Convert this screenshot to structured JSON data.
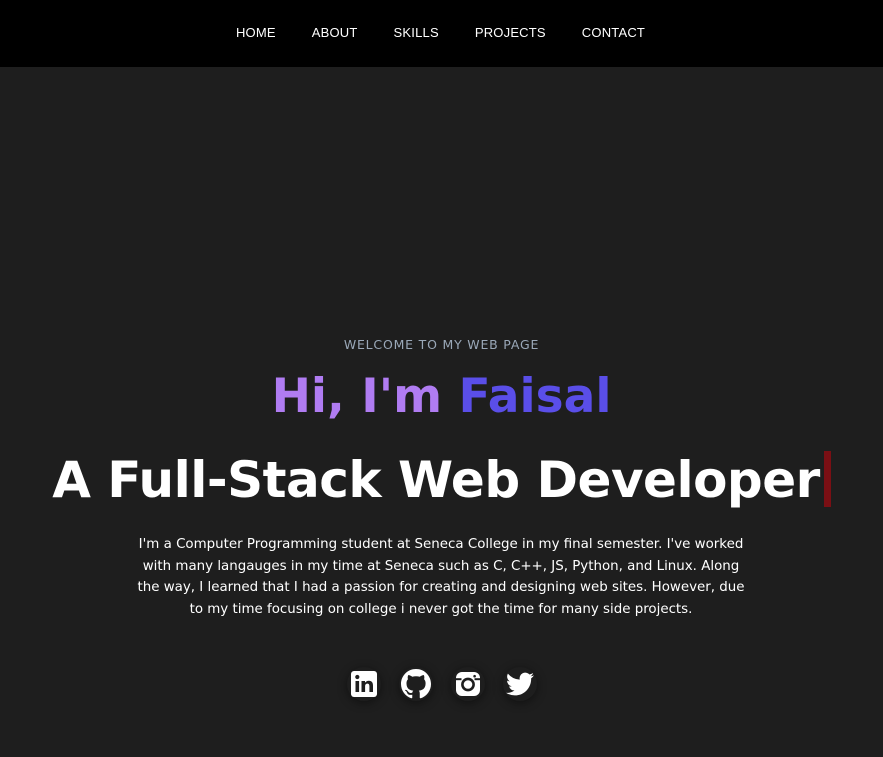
{
  "nav": {
    "items": [
      {
        "label": "HOME"
      },
      {
        "label": "ABOUT"
      },
      {
        "label": "SKILLS"
      },
      {
        "label": "PROJECTS"
      },
      {
        "label": "CONTACT"
      }
    ]
  },
  "hero": {
    "welcome": "WELCOME TO MY WEB PAGE",
    "greeting": "Hi, I'm ",
    "name": "Faisal",
    "role": "A Full-Stack Web Developer",
    "bio": "I'm a Computer Programming student at Seneca College in my final semester. I've worked with many langauges in my time at Seneca such as C, C++, JS, Python, and Linux. Along the way, I learned that I had a passion for creating and designing web sites. However, due to my time focusing on college i never got the time for many side projects."
  },
  "socials": [
    {
      "icon": "linkedin-icon"
    },
    {
      "icon": "github-icon"
    },
    {
      "icon": "instagram-icon"
    },
    {
      "icon": "twitter-icon"
    }
  ],
  "colors": {
    "background": "#1e1e1e",
    "navbar": "#000000",
    "greeting": "#b07cf2",
    "name": "#5a4ee8",
    "cursor": "#7a0f14",
    "welcome": "#9aa8b8"
  }
}
